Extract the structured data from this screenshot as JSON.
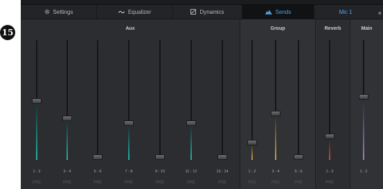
{
  "callout": {
    "number": "15"
  },
  "tabs": [
    {
      "label": "Settings",
      "icon": "gear-icon"
    },
    {
      "label": "Equalizer",
      "icon": "equalizer-icon"
    },
    {
      "label": "Dynamics",
      "icon": "dynamics-icon"
    },
    {
      "label": "Sends",
      "icon": "sends-icon",
      "active": true
    },
    {
      "label": "Mic 1"
    }
  ],
  "close_label": "×",
  "groups": [
    {
      "title": "Aux"
    },
    {
      "title": "Group"
    },
    {
      "title": "Reverb"
    },
    {
      "title": "Main"
    }
  ],
  "colors": {
    "aux": "#27b3a6",
    "group": "#c9a24e",
    "reverb": "#c2514f",
    "main": "#9b7fc4",
    "accent": "#4ea4e8"
  },
  "channels": [
    {
      "label": "1 - 2",
      "pre": "PRE",
      "group": "aux",
      "level": 0.49
    },
    {
      "label": "3 - 4",
      "pre": "PRE",
      "group": "aux",
      "level": 0.34
    },
    {
      "label": "5 - 6",
      "pre": "PRE",
      "group": "aux",
      "level": 0.0
    },
    {
      "label": "7 - 8",
      "pre": "PRE",
      "group": "aux",
      "level": 0.3
    },
    {
      "label": "9 - 10",
      "pre": "PRE",
      "group": "aux",
      "level": 0.0
    },
    {
      "label": "11 - 12",
      "pre": "PRE",
      "group": "aux",
      "level": 0.3
    },
    {
      "label": "13 - 14",
      "pre": "PRE",
      "group": "aux",
      "level": 0.0
    },
    {
      "label": "1 - 2",
      "pre": "PRE",
      "group": "group",
      "level": 0.13
    },
    {
      "label": "3 - 4",
      "pre": "PRE",
      "group": "group",
      "level": 0.38
    },
    {
      "label": "5 - 6",
      "pre": "PRE",
      "group": "group",
      "level": 0.0
    },
    {
      "label": "1 - 2",
      "pre": "PRE",
      "group": "reverb",
      "level": 0.18
    },
    {
      "label": "1 - 2",
      "pre": "",
      "group": "main",
      "level": 0.53
    }
  ]
}
